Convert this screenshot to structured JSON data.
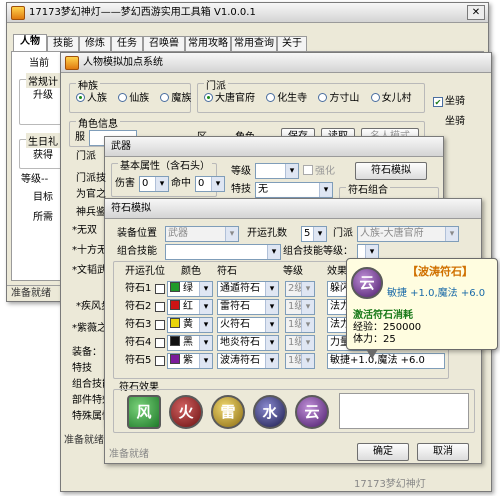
{
  "main": {
    "title": "17173梦幻神灯——梦幻西游实用工具箱 V1.0.0.1",
    "close": "✕",
    "tabs": [
      "人物",
      "技能",
      "修炼",
      "任务",
      "召唤兽",
      "常用攻略",
      "常用查询",
      "关于"
    ],
    "left_labels": {
      "dangqian": "当前",
      "changgui": "常规计",
      "shengji": "升级",
      "shengri": "生日礼",
      "huode": "获得",
      "dengji": "等级--",
      "mubiao": "目标",
      "suoxu": "所需"
    },
    "status": "准备就绪"
  },
  "attr": {
    "title": "人物模拟加点系统",
    "race_label": "种族",
    "races": [
      "人族",
      "仙族",
      "魔族"
    ],
    "school_label": "门派",
    "schools": [
      "大唐官府",
      "化生寺",
      "方寸山",
      "女儿村"
    ],
    "mount": "坐骑",
    "mount2": "坐骑",
    "role_label": "角色信息",
    "clothes": "服",
    "right_labels": [
      "区",
      "角色",
      "保存",
      "读取",
      "名人模式"
    ]
  },
  "weapon": {
    "title": "武器",
    "base_label": "基本属性（含石头）",
    "level_label": "等级",
    "strengthen": "强化",
    "gem_button": "符石模拟",
    "hurt": "伤害",
    "hurt_val": "0",
    "hit": "命中",
    "hit_val": "0",
    "special": "特技",
    "special_val": "无",
    "combo": "符石组合",
    "left_labels": [
      "门派",
      "门派技",
      "为官之",
      "神兵鉴",
      "*无双",
      "*十方无",
      "*文韬武",
      "*疾风步",
      "*紫薇之",
      "装备：",
      "特技",
      "组合技能",
      "部件特效",
      "特殊属性"
    ]
  },
  "gem": {
    "title": "符石模拟",
    "slot_label": "装备位置",
    "slot": "武器",
    "holes_label": "开运孔数",
    "holes": "5",
    "school_label": "门派",
    "school": "人族-大唐官府",
    "combo_label": "组合技能",
    "combo_level_label": "组合技能等级：",
    "col_holes": "开运孔位",
    "col_color": "颜色",
    "col_gem": "符石",
    "col_level": "等级",
    "col_effect": "效果",
    "rows": [
      {
        "name": "符石1",
        "color": "绿",
        "swatch": "#1f9a2a",
        "gem": "通遁符石",
        "level": "2级",
        "effect": "躲闪"
      },
      {
        "name": "符石2",
        "color": "红",
        "swatch": "#cc1414",
        "gem": "雷符石",
        "level": "1级",
        "effect": "法力"
      },
      {
        "name": "符石3",
        "color": "黄",
        "swatch": "#e8d40a",
        "gem": "火符石",
        "level": "1级",
        "effect": "法力"
      },
      {
        "name": "符石4",
        "color": "黑",
        "swatch": "#111111",
        "gem": "地炎符石",
        "level": "1级",
        "effect": "力量"
      },
      {
        "name": "符石5",
        "color": "紫",
        "swatch": "#7a1a9a",
        "gem": "波涛符石",
        "level": "1级",
        "effect": "敏捷+1.0,魔法 +6.0"
      }
    ],
    "effect_section": "符石效果",
    "orbs": [
      {
        "glyph": "风",
        "color": "#1f7a2a"
      },
      {
        "glyph": "火",
        "color": "#8a1a1a"
      },
      {
        "glyph": "雷",
        "color": "#b8941a"
      },
      {
        "glyph": "水",
        "color": "#2a2a6a"
      },
      {
        "glyph": "云",
        "color": "#5a2a7a"
      }
    ],
    "ok": "确定",
    "cancel": "取消",
    "status": "准备就绪"
  },
  "tooltip": {
    "title": "【波涛符石】",
    "line1": "敏捷 +1.0,魔法 +6.0",
    "consume_title": "激活符石消耗",
    "exp_label": "经验：",
    "exp": "250000",
    "hp_label": "体力：",
    "hp": "25"
  },
  "footer": {
    "caption": "17173梦幻神灯"
  }
}
